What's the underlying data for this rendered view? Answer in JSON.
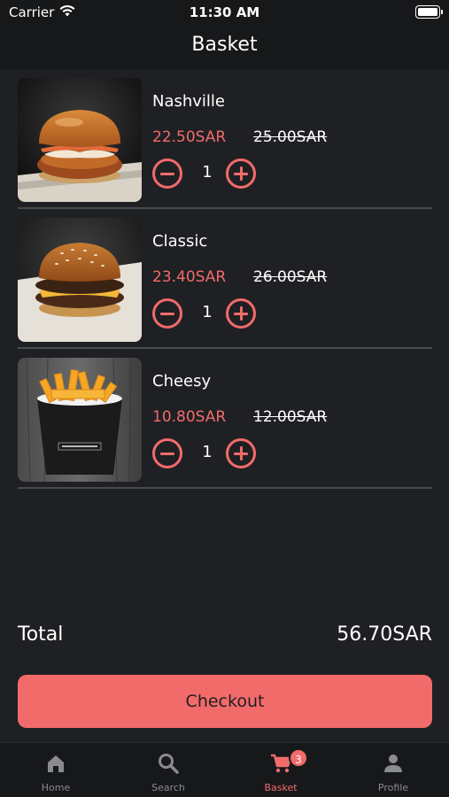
{
  "status_bar": {
    "carrier": "Carrier",
    "time": "11:30 AM"
  },
  "header": {
    "title": "Basket"
  },
  "items": [
    {
      "name": "Nashville",
      "price": "22.50SAR",
      "old_price": "25.00SAR",
      "quantity": "1"
    },
    {
      "name": "Classic",
      "price": "23.40SAR",
      "old_price": "26.00SAR",
      "quantity": "1"
    },
    {
      "name": "Cheesy",
      "price": "10.80SAR",
      "old_price": "12.00SAR",
      "quantity": "1"
    }
  ],
  "summary": {
    "total_label": "Total",
    "total_value": "56.70SAR"
  },
  "checkout": {
    "label": "Checkout"
  },
  "tabs": [
    {
      "label": "Home",
      "icon": "home-icon"
    },
    {
      "label": "Search",
      "icon": "search-icon"
    },
    {
      "label": "Basket",
      "icon": "cart-icon",
      "badge": "3",
      "active": true
    },
    {
      "label": "Profile",
      "icon": "person-icon"
    }
  ],
  "colors": {
    "accent": "#f26b6b",
    "background": "#1f2023",
    "bar": "#17181a",
    "divider": "#4a4b4f",
    "inactive": "#8a8b8f"
  }
}
